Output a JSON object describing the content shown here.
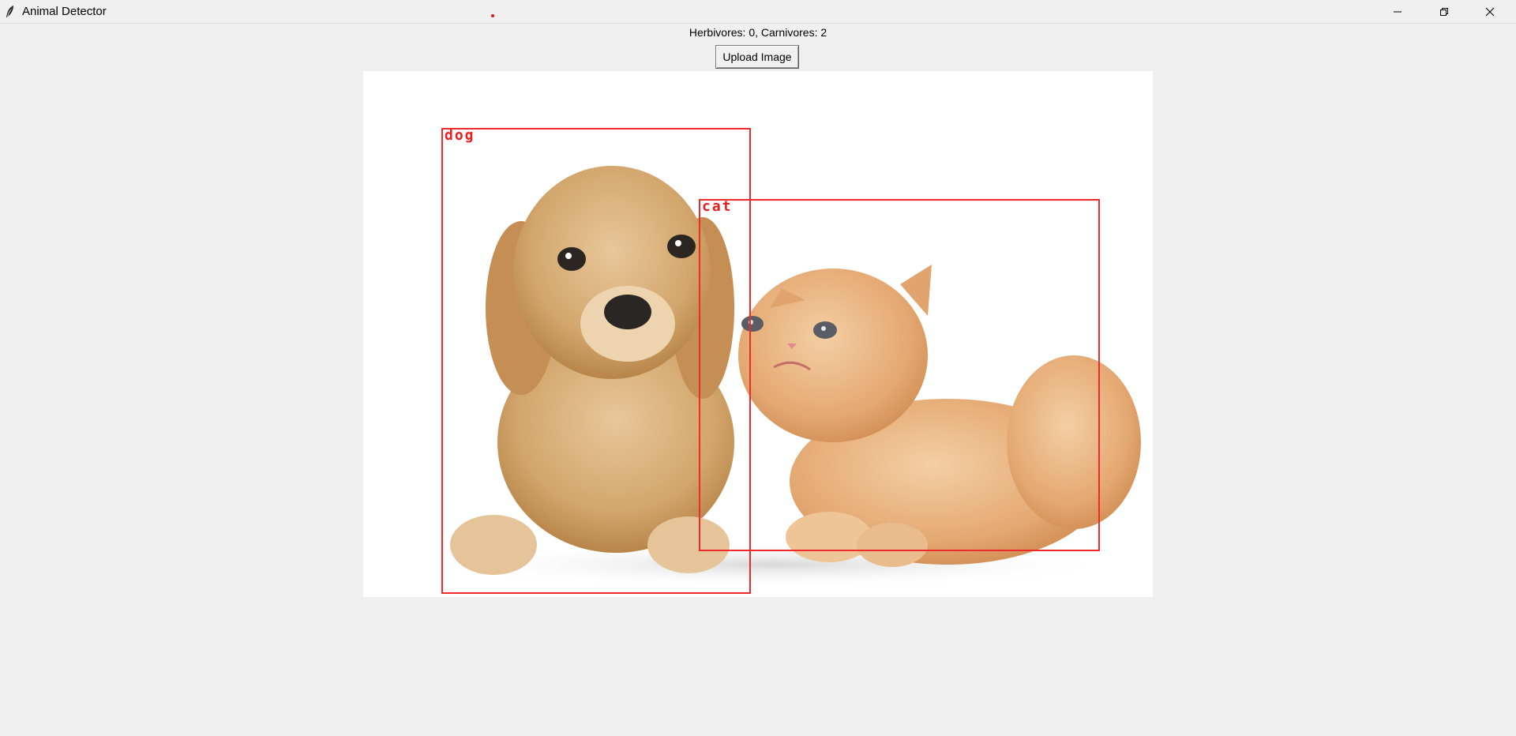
{
  "window": {
    "title": "Animal Detector"
  },
  "status": {
    "text": "Herbivores: 0, Carnivores: 2"
  },
  "toolbar": {
    "upload_label": "Upload Image"
  },
  "detections": [
    {
      "label": "dog"
    },
    {
      "label": "cat"
    }
  ],
  "icons": {
    "app": "feather-icon",
    "minimize": "minimize-icon",
    "restore": "restore-icon",
    "close": "close-icon"
  },
  "colors": {
    "bbox": "#ee2a2a",
    "window_bg": "#f0f0f0",
    "image_bg": "#ffffff"
  }
}
